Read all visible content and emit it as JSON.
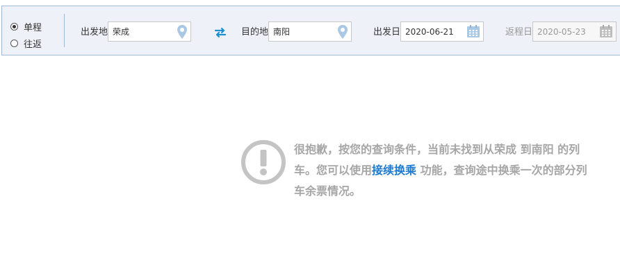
{
  "trip_type": {
    "options": [
      {
        "label": "单程",
        "checked": true
      },
      {
        "label": "往返",
        "checked": false
      }
    ]
  },
  "from": {
    "label": "出发地",
    "value": "荣成",
    "icon": "location-pin-icon"
  },
  "swap": {
    "icon": "swap-arrows-icon"
  },
  "to": {
    "label": "目的地",
    "value": "南阳",
    "icon": "location-pin-icon"
  },
  "depart_date": {
    "label": "出发日",
    "value": "2020-06-21",
    "icon": "calendar-icon"
  },
  "return_date": {
    "label": "返程日",
    "value": "2020-05-23",
    "icon": "calendar-icon",
    "disabled": true
  },
  "result": {
    "icon": "exclamation-circle-icon",
    "text_before": "很抱歉，按您的查询条件，当前未找到从荣成 到南阳 的列车。您可以使用",
    "link": "接续换乘",
    "text_after": " 功能，查询途中换乘一次的部分列车余票情况。"
  },
  "colors": {
    "accent": "#1d7ad3",
    "bar_bg": "#eef1f8",
    "bar_border": "#9fb9d7",
    "message_text": "#a6a6a6",
    "icon": "#a9c8e4"
  }
}
